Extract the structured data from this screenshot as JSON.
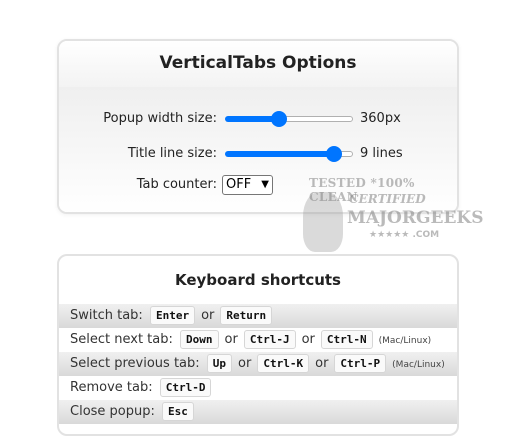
{
  "options": {
    "title": "VerticalTabs Options",
    "popup_width": {
      "label": "Popup width size:",
      "value_text": "360px",
      "level": 0.41
    },
    "title_lines": {
      "label": "Title line size:",
      "value_text": "9 lines",
      "level": 0.9
    },
    "tab_counter": {
      "label": "Tab counter:",
      "selected": "OFF"
    }
  },
  "watermark": {
    "line1": "TESTED *100% CLEAN",
    "line2": "CERTIFIED",
    "line3": "MAJORGEEKS",
    "line4": "★★★★★ .COM"
  },
  "shortcuts": {
    "title": "Keyboard shortcuts",
    "or": "or",
    "rows": [
      {
        "label": "Switch tab:",
        "keys": [
          "Enter",
          "Return"
        ],
        "note": ""
      },
      {
        "label": "Select next tab:",
        "keys": [
          "Down",
          "Ctrl-J",
          "Ctrl-N"
        ],
        "note": "(Mac/Linux)"
      },
      {
        "label": "Select previous tab:",
        "keys": [
          "Up",
          "Ctrl-K",
          "Ctrl-P"
        ],
        "note": "(Mac/Linux)"
      },
      {
        "label": "Remove tab:",
        "keys": [
          "Ctrl-D"
        ],
        "note": ""
      },
      {
        "label": "Close popup:",
        "keys": [
          "Esc"
        ],
        "note": ""
      }
    ]
  },
  "colors": {
    "accent": "#0075ff",
    "row_shade": "#dcdcdc"
  }
}
